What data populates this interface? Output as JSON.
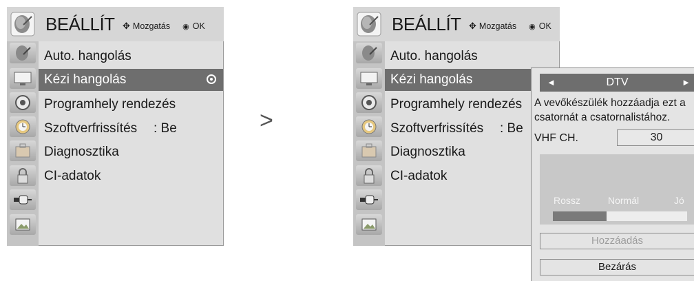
{
  "screens": [
    {
      "title": "BEÁLLÍT",
      "nav_hint": "Mozgatás",
      "ok_hint": "OK",
      "items": [
        {
          "label": "Auto. hangolás",
          "value": ""
        },
        {
          "label": "Kézi hangolás",
          "value": ""
        },
        {
          "label": "Programhely rendezés",
          "value": ""
        },
        {
          "label": "Szoftverfrissítés",
          "value": ": Be"
        },
        {
          "label": "Diagnosztika",
          "value": ""
        },
        {
          "label": "CI-adatok",
          "value": ""
        }
      ],
      "selected_index": 1
    },
    {
      "title": "BEÁLLÍT",
      "nav_hint": "Mozgatás",
      "ok_hint": "OK",
      "items": [
        {
          "label": "Auto. hangolás",
          "value": ""
        },
        {
          "label": "Kézi hangolás",
          "value": ""
        },
        {
          "label": "Programhely rendezés",
          "value": ""
        },
        {
          "label": "Szoftverfrissítés",
          "value": ": Be"
        },
        {
          "label": "Diagnosztika",
          "value": ""
        },
        {
          "label": "CI-adatok",
          "value": ""
        }
      ],
      "selected_index": 1
    }
  ],
  "separator": ">",
  "sidebar_icons": [
    "setup-satellite-icon",
    "tv-screen-icon",
    "speaker-icon",
    "clock-icon",
    "briefcase-icon",
    "lock-icon",
    "input-plug-icon",
    "photo-icon"
  ],
  "popup": {
    "channel_type": "DTV",
    "message_line1": "A vevőkészülék hozzáadja ezt a",
    "message_line2": "csatornát a csatornalistához.",
    "vhf_label": "VHF CH.",
    "vhf_value": "30",
    "signal_labels": {
      "bad": "Rossz",
      "normal": "Normál",
      "good": "Jó"
    },
    "signal_level": 0.4,
    "add_button": "Hozzáadás",
    "close_button": "Bezárás"
  },
  "colors": {
    "selected_row": "#6e6e6e",
    "header_bg": "#d6d6d6",
    "list_bg": "#e0e0e0"
  }
}
